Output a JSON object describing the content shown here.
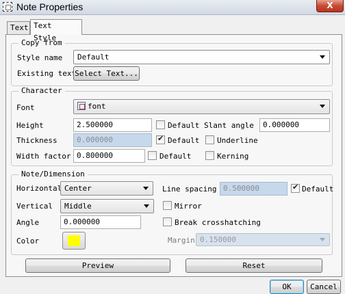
{
  "window": {
    "title": "Note Properties",
    "close_glyph": "X"
  },
  "tabs": [
    {
      "label": "Text",
      "active": false
    },
    {
      "label": "Text Style",
      "active": true
    }
  ],
  "copy_from": {
    "title": "Copy from",
    "style_name_label": "Style name",
    "style_name_value": "Default",
    "existing_text_label": "Existing text",
    "select_text_button": "Select Text..."
  },
  "character": {
    "title": "Character",
    "font_label": "Font",
    "font_value": "font",
    "font_icon": "font-file-icon",
    "height_label": "Height",
    "height_value": "2.500000",
    "height_default_label": "Default",
    "height_default_checked": false,
    "slant_angle_label": "Slant angle",
    "slant_angle_value": "0.000000",
    "thickness_label": "Thickness",
    "thickness_value": "0.000000",
    "thickness_default_label": "Default",
    "thickness_default_checked": true,
    "underline_label": "Underline",
    "underline_checked": false,
    "width_factor_label": "Width factor",
    "width_factor_value": "0.800000",
    "width_default_label": "Default",
    "width_default_checked": false,
    "kerning_label": "Kerning",
    "kerning_checked": false
  },
  "note_dimension": {
    "title": "Note/Dimension",
    "horizontal_label": "Horizontal",
    "horizontal_value": "Center",
    "vertical_label": "Vertical",
    "vertical_value": "Middle",
    "angle_label": "Angle",
    "angle_value": "0.000000",
    "color_label": "Color",
    "color_value": "#ffff00",
    "line_spacing_label": "Line spacing",
    "line_spacing_value": "0.500000",
    "line_spacing_default_label": "Default",
    "line_spacing_default_checked": true,
    "mirror_label": "Mirror",
    "mirror_checked": false,
    "break_crosshatching_label": "Break crosshatching",
    "break_crosshatching_checked": false,
    "margin_label": "Margin",
    "margin_value": "0.150000"
  },
  "buttons": {
    "preview": "Preview",
    "reset": "Reset",
    "ok": "OK",
    "cancel": "Cancel"
  }
}
